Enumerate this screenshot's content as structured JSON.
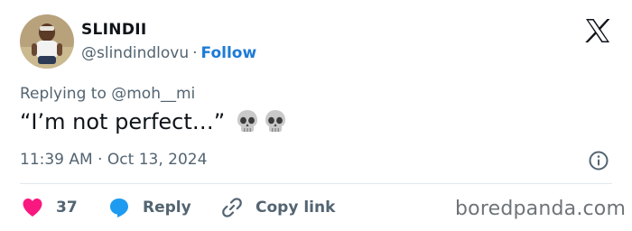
{
  "author": {
    "display_name": "SLINDII",
    "handle": "@slindindlovu",
    "separator": "·",
    "follow_label": "Follow"
  },
  "header": {
    "logo_icon": "x-logo-icon"
  },
  "reply_context": {
    "prefix": "Replying to",
    "handle": "@moh__mi"
  },
  "tweet": {
    "text": "“I’m not perfect…”",
    "emoji": [
      "skull-icon",
      "skull-icon"
    ]
  },
  "meta": {
    "time": "11:39 AM",
    "separator": "·",
    "date": "Oct 13, 2024",
    "info_icon": "info-icon"
  },
  "actions": {
    "like_count": "37",
    "reply_label": "Reply",
    "copy_label": "Copy link"
  },
  "colors": {
    "like": "#f91880",
    "reply": "#1d9bf0",
    "follow": "#1d7bd6",
    "secondary_text": "#536471"
  },
  "watermark": "boredpanda.com"
}
